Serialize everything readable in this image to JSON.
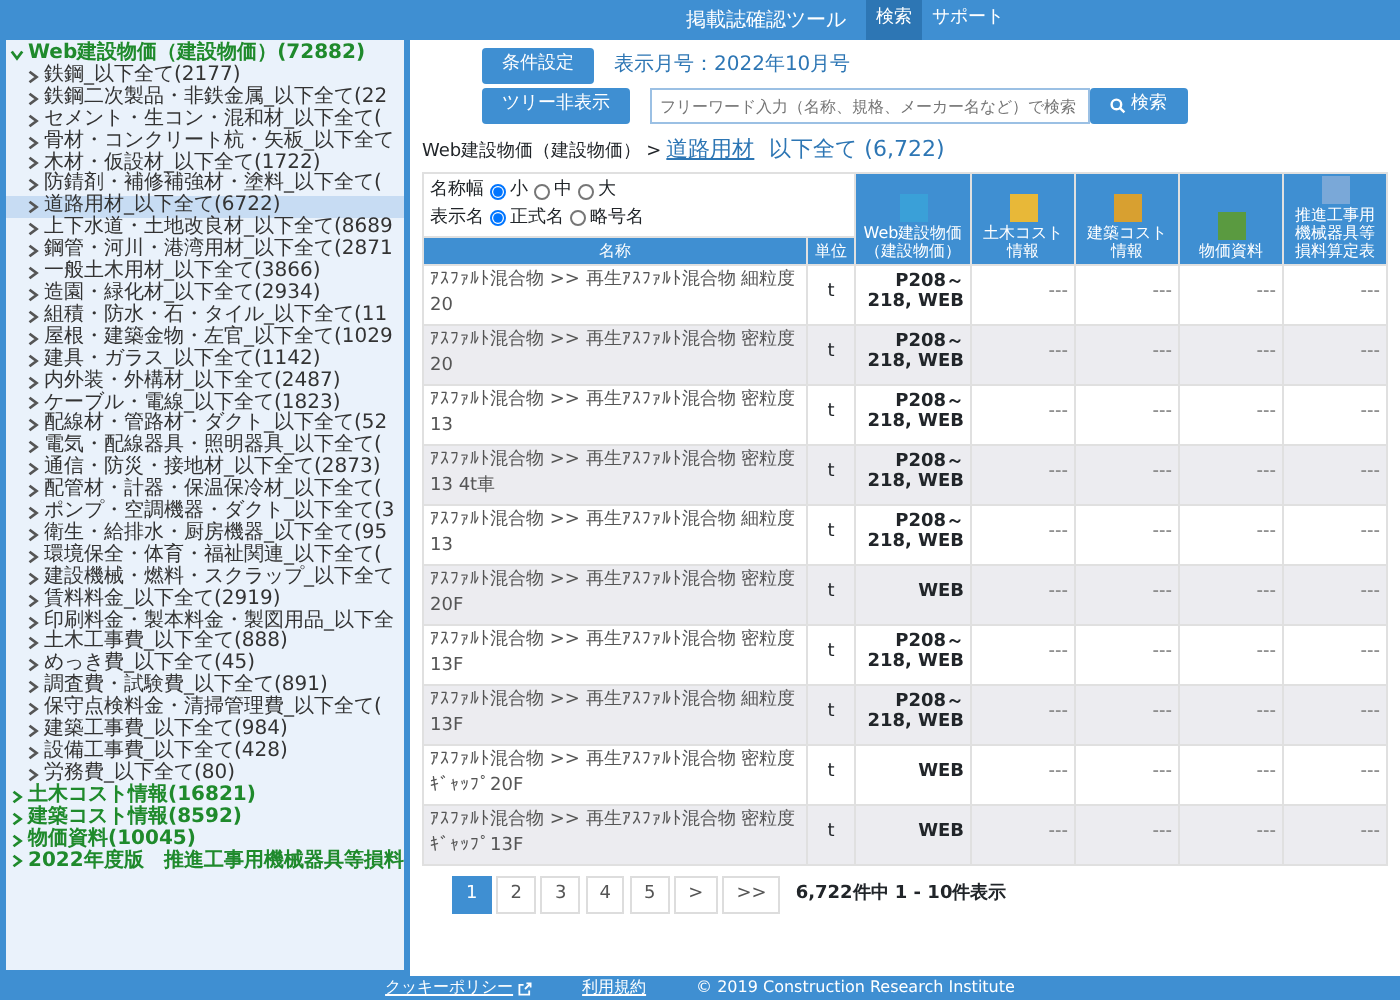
{
  "header": {
    "title": "掲載誌確認ツール",
    "nav": [
      {
        "label": "検索",
        "selected": true
      },
      {
        "label": "サポート",
        "selected": false
      }
    ]
  },
  "sidebar": {
    "tree": [
      {
        "label": "Web建設物価（建設物価）(72882)",
        "expanded": true,
        "selected": false,
        "children": [
          {
            "label": "鉄鋼_以下全て(2177)",
            "expanded": false,
            "selected": false
          },
          {
            "label": "鉄鋼二次製品・非鉄金属_以下全て(22",
            "expanded": false,
            "selected": false
          },
          {
            "label": "セメント・生コン・混和材_以下全て(",
            "expanded": false,
            "selected": false
          },
          {
            "label": "骨材・コンクリート杭・矢板_以下全て",
            "expanded": false,
            "selected": false
          },
          {
            "label": "木材・仮設材_以下全て(1722)",
            "expanded": false,
            "selected": false
          },
          {
            "label": "防錆剤・補修補強材・塗料_以下全て(",
            "expanded": false,
            "selected": false
          },
          {
            "label": "道路用材_以下全て(6722)",
            "expanded": false,
            "selected": true
          },
          {
            "label": "上下水道・土地改良材_以下全て(8689",
            "expanded": false,
            "selected": false
          },
          {
            "label": "鋼管・河川・港湾用材_以下全て(2871",
            "expanded": false,
            "selected": false
          },
          {
            "label": "一般土木用材_以下全て(3866)",
            "expanded": false,
            "selected": false
          },
          {
            "label": "造園・緑化材_以下全て(2934)",
            "expanded": false,
            "selected": false
          },
          {
            "label": "組積・防水・石・タイル_以下全て(11",
            "expanded": false,
            "selected": false
          },
          {
            "label": "屋根・建築金物・左官_以下全て(1029",
            "expanded": false,
            "selected": false
          },
          {
            "label": "建具・ガラス_以下全て(1142)",
            "expanded": false,
            "selected": false
          },
          {
            "label": "内外装・外構材_以下全て(2487)",
            "expanded": false,
            "selected": false
          },
          {
            "label": "ケーブル・電線_以下全て(1823)",
            "expanded": false,
            "selected": false
          },
          {
            "label": "配線材・管路材・ダクト_以下全て(52",
            "expanded": false,
            "selected": false
          },
          {
            "label": "電気・配線器具・照明器具_以下全て(",
            "expanded": false,
            "selected": false
          },
          {
            "label": "通信・防災・接地材_以下全て(2873)",
            "expanded": false,
            "selected": false
          },
          {
            "label": "配管材・計器・保温保冷材_以下全て(",
            "expanded": false,
            "selected": false
          },
          {
            "label": "ポンプ・空調機器・ダクト_以下全て(3",
            "expanded": false,
            "selected": false
          },
          {
            "label": "衛生・給排水・厨房機器_以下全て(95",
            "expanded": false,
            "selected": false
          },
          {
            "label": "環境保全・体育・福祉関連_以下全て(",
            "expanded": false,
            "selected": false
          },
          {
            "label": "建設機械・燃料・スクラップ_以下全て",
            "expanded": false,
            "selected": false
          },
          {
            "label": "賃料料金_以下全て(2919)",
            "expanded": false,
            "selected": false
          },
          {
            "label": "印刷料金・製本料金・製図用品_以下全",
            "expanded": false,
            "selected": false
          },
          {
            "label": "土木工事費_以下全て(888)",
            "expanded": false,
            "selected": false
          },
          {
            "label": "めっき費_以下全て(45)",
            "expanded": false,
            "selected": false
          },
          {
            "label": "調査費・試験費_以下全て(891)",
            "expanded": false,
            "selected": false
          },
          {
            "label": "保守点検料金・清掃管理費_以下全て(",
            "expanded": false,
            "selected": false
          },
          {
            "label": "建築工事費_以下全て(984)",
            "expanded": false,
            "selected": false
          },
          {
            "label": "設備工事費_以下全て(428)",
            "expanded": false,
            "selected": false
          },
          {
            "label": "労務費_以下全て(80)",
            "expanded": false,
            "selected": false
          }
        ]
      },
      {
        "label": "土木コスト情報(16821)",
        "expanded": false,
        "selected": false
      },
      {
        "label": "建築コスト情報(8592)",
        "expanded": false,
        "selected": false
      },
      {
        "label": "物価資料(10045)",
        "expanded": false,
        "selected": false
      },
      {
        "label": "2022年度版　推進工事用機械器具等損料",
        "expanded": false,
        "selected": false
      }
    ]
  },
  "toolbar": {
    "condition_button": "条件設定",
    "issue": "表示月号：2022年10月号",
    "tree_button": "ツリー非表示",
    "search": {
      "placeholder": "フリーワード入力（名称、規格、メーカー名など）で検索"
    },
    "search_button": "検索"
  },
  "breadcrumb": {
    "root": "Web建設物価（建設物価）",
    "separator": ">",
    "current": "道路用材",
    "scope": "以下全て (6,722)"
  },
  "filters": [
    {
      "label": "名称幅",
      "options": [
        {
          "label": "小",
          "selected": true
        },
        {
          "label": "中",
          "selected": false
        },
        {
          "label": "大",
          "selected": false
        }
      ]
    },
    {
      "label": "表示名",
      "options": [
        {
          "label": "正式名",
          "selected": true
        },
        {
          "label": "略号名",
          "selected": false
        }
      ]
    }
  ],
  "table": {
    "columns": [
      "名称",
      "単位"
    ],
    "sources": [
      "Web建設物価（建設物価）",
      "土木コスト情報",
      "建築コスト情報",
      "物価資料",
      "推進工事用機械器具等損料算定表"
    ],
    "rows": [
      [
        "ｱｽﾌｧﾙﾄ混合物 >> 再生ｱｽﾌｧﾙﾄ混合物 細粒度20",
        "t",
        "P208～218, WEB",
        "---",
        "---",
        "---",
        "---"
      ],
      [
        "ｱｽﾌｧﾙﾄ混合物 >> 再生ｱｽﾌｧﾙﾄ混合物 密粒度20",
        "t",
        "P208～218, WEB",
        "---",
        "---",
        "---",
        "---"
      ],
      [
        "ｱｽﾌｧﾙﾄ混合物 >> 再生ｱｽﾌｧﾙﾄ混合物 密粒度13",
        "t",
        "P208～218, WEB",
        "---",
        "---",
        "---",
        "---"
      ],
      [
        "ｱｽﾌｧﾙﾄ混合物 >> 再生ｱｽﾌｧﾙﾄ混合物 密粒度13 4t車",
        "t",
        "P208～218, WEB",
        "---",
        "---",
        "---",
        "---"
      ],
      [
        "ｱｽﾌｧﾙﾄ混合物 >> 再生ｱｽﾌｧﾙﾄ混合物 細粒度13",
        "t",
        "P208～218, WEB",
        "---",
        "---",
        "---",
        "---"
      ],
      [
        "ｱｽﾌｧﾙﾄ混合物 >> 再生ｱｽﾌｧﾙﾄ混合物 密粒度20F",
        "t",
        "WEB",
        "---",
        "---",
        "---",
        "---"
      ],
      [
        "ｱｽﾌｧﾙﾄ混合物 >> 再生ｱｽﾌｧﾙﾄ混合物 密粒度13F",
        "t",
        "P208～218, WEB",
        "---",
        "---",
        "---",
        "---"
      ],
      [
        "ｱｽﾌｧﾙﾄ混合物 >> 再生ｱｽﾌｧﾙﾄ混合物 細粒度13F",
        "t",
        "P208～218, WEB",
        "---",
        "---",
        "---",
        "---"
      ],
      [
        "ｱｽﾌｧﾙﾄ混合物 >> 再生ｱｽﾌｧﾙﾄ混合物 密粒度ｷﾞｬｯﾌﾟ20F",
        "t",
        "WEB",
        "---",
        "---",
        "---",
        "---"
      ],
      [
        "ｱｽﾌｧﾙﾄ混合物 >> 再生ｱｽﾌｧﾙﾄ混合物 密粒度ｷﾞｬｯﾌﾟ13F",
        "t",
        "WEB",
        "---",
        "---",
        "---",
        "---"
      ]
    ]
  },
  "pagination": {
    "pages": [
      {
        "label": "1",
        "selected": true
      },
      {
        "label": "2",
        "selected": false
      },
      {
        "label": "3",
        "selected": false
      },
      {
        "label": "4",
        "selected": false
      },
      {
        "label": "5",
        "selected": false
      },
      {
        "label": ">",
        "selected": false
      },
      {
        "label": ">>",
        "selected": false
      }
    ],
    "summary": "6,722件中 1 - 10件表示"
  },
  "footer": {
    "cookie": "クッキーポリシー",
    "terms": "利用規約",
    "copyright": "© 2019 Construction Research Institute"
  }
}
